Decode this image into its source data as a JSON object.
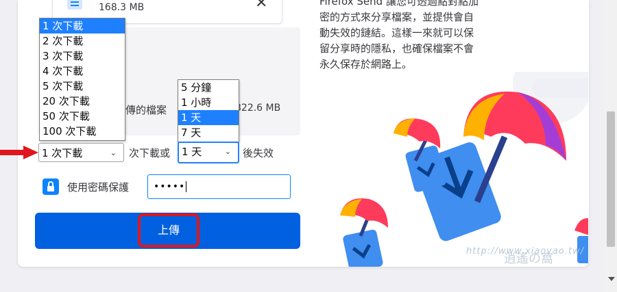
{
  "file": {
    "size": "168.3 MB"
  },
  "panel": {
    "text": "傳的檔案",
    "size": "822.6 MB"
  },
  "downloads_dropdown": {
    "options": [
      "1 次下載",
      "2 次下載",
      "3 次下載",
      "4 次下載",
      "5 次下載",
      "20 次下載",
      "50 次下載",
      "100 次下載"
    ],
    "selected_index": 0
  },
  "time_dropdown": {
    "options": [
      "5 分鐘",
      "1 小時",
      "1 天",
      "7 天"
    ],
    "selected_index": 2
  },
  "expiry": {
    "downloads_value": "1 次下載",
    "middle_label": "次下載或",
    "time_value": "1 天",
    "suffix_label": "後失效"
  },
  "password": {
    "label": "使用密碼保護",
    "value": "•••••"
  },
  "upload_button": {
    "label": "上傳"
  },
  "description": {
    "lines": [
      "Firefox Send 讓您可透過點對點加",
      "密的方式來分享檔案，並提供會自",
      "動失效的鏈結。這樣一來就可以保",
      "留分享時的隱私，也確保檔案不會",
      "永久保存於網路上。"
    ]
  },
  "watermark": {
    "text": "http://www.xiaoyao.tw/",
    "logo_text": "逍遙の窩"
  },
  "colors": {
    "accent": "#0060df",
    "selection": "#1e80ff",
    "annotation": "#e0161e"
  }
}
